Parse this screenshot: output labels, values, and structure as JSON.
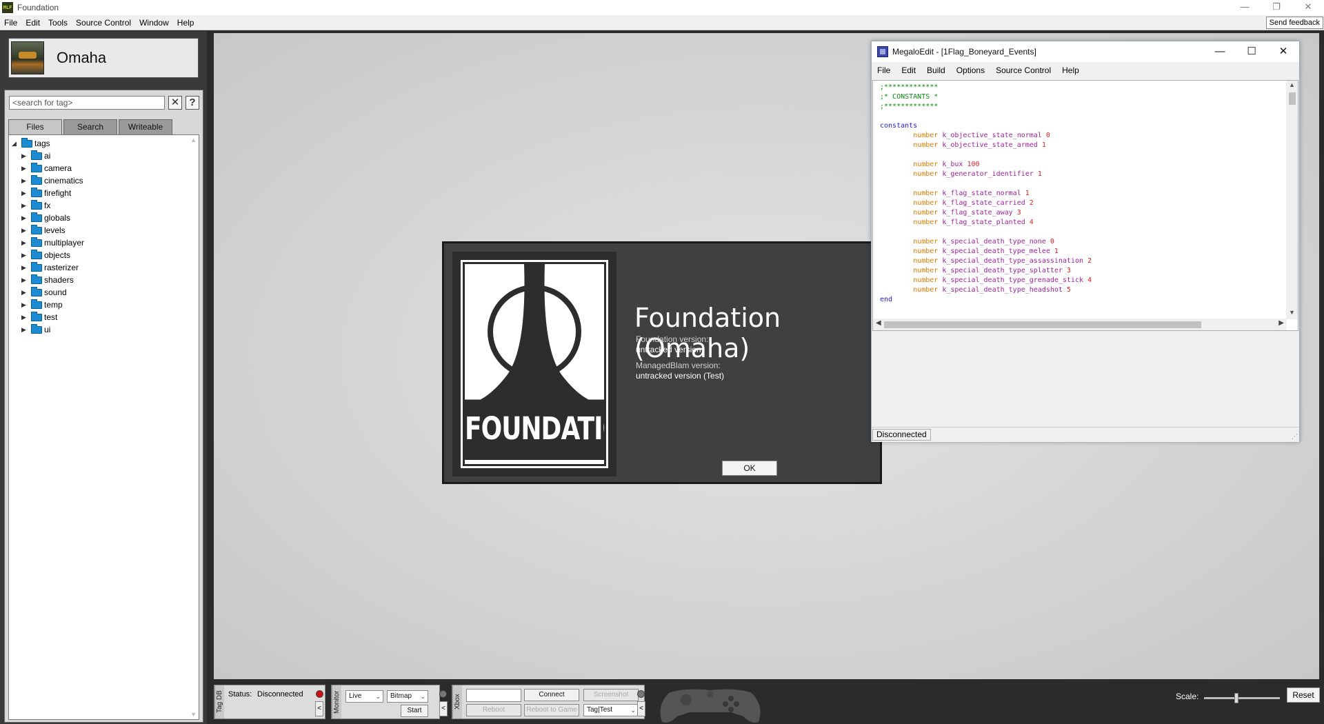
{
  "window": {
    "title": "Foundation",
    "app_icon_text": "MLF"
  },
  "menu": [
    "File",
    "Edit",
    "Tools",
    "Source Control",
    "Window",
    "Help"
  ],
  "feedback_button": "Send feedback",
  "profile": {
    "name": "Omaha"
  },
  "tag_panel": {
    "search_placeholder": "<search for tag>",
    "clear_button": "✕",
    "help_button": "?",
    "tabs": [
      "Files",
      "Search",
      "Writeable"
    ],
    "active_tab": "Files",
    "root": "tags",
    "folders": [
      "ai",
      "camera",
      "cinematics",
      "firefight",
      "fx",
      "globals",
      "levels",
      "multiplayer",
      "objects",
      "rasterizer",
      "shaders",
      "sound",
      "temp",
      "test",
      "ui"
    ]
  },
  "bottom_bar": {
    "tagdb_label": "Tag DB",
    "status_label": "Status:",
    "status_value": "Disconnected",
    "collapse_glyph": "<",
    "monitor_label": "Monitor",
    "monitor_mode": "Live",
    "monitor_type": "Bitmap",
    "start_button": "Start",
    "xbox_label": "Xbox",
    "connect_button": "Connect",
    "screenshot_button": "Screenshot",
    "reboot_button": "Reboot",
    "reboot_to_game_button": "Reboot to Game",
    "target_combo": "Tag|Test",
    "scale_label": "Scale:",
    "scale_fraction": 0.42,
    "reset_button": "Reset"
  },
  "about": {
    "logo_text": "FOUNDATION",
    "heading": "Foundation (Omaha)",
    "foundation_version_label": "Foundation version:",
    "foundation_version_value": "untracked version",
    "managedblam_version_label": "ManagedBlam version:",
    "managedblam_version_value": "untracked version (Test)",
    "ok_button": "OK"
  },
  "megalo": {
    "title": "MegaloEdit - [1Flag_Boneyard_Events]",
    "menu": [
      "File",
      "Edit",
      "Build",
      "Options",
      "Source Control",
      "Help"
    ],
    "status": "Disconnected",
    "code": {
      "comment_line": ";*************",
      "comment_title": ";* CONSTANTS *",
      "constants_kw": "constants",
      "end_kw": "end",
      "type_kw": "number",
      "groups": [
        [
          [
            "k_objective_state_normal",
            "0"
          ],
          [
            "k_objective_state_armed",
            "1"
          ]
        ],
        [
          [
            "k_bux",
            "100"
          ],
          [
            "k_generator_identifier",
            "1"
          ]
        ],
        [
          [
            "k_flag_state_normal",
            "1"
          ],
          [
            "k_flag_state_carried",
            "2"
          ],
          [
            "k_flag_state_away",
            "3"
          ],
          [
            "k_flag_state_planted",
            "4"
          ]
        ],
        [
          [
            "k_special_death_type_none",
            "0"
          ],
          [
            "k_special_death_type_melee",
            "1"
          ],
          [
            "k_special_death_type_assassination",
            "2"
          ],
          [
            "k_special_death_type_splatter",
            "3"
          ],
          [
            "k_special_death_type_grenade_stick",
            "4"
          ],
          [
            "k_special_death_type_headshot",
            "5"
          ]
        ]
      ]
    }
  },
  "colors": {
    "folder_blue": "#1d8bd1",
    "code_comment": "#0a8a0a",
    "code_keyword": "#1a1ae6",
    "code_type": "#e07b00",
    "code_identifier": "#a020a0",
    "code_number": "#e02020",
    "status_led": "#d01010"
  }
}
